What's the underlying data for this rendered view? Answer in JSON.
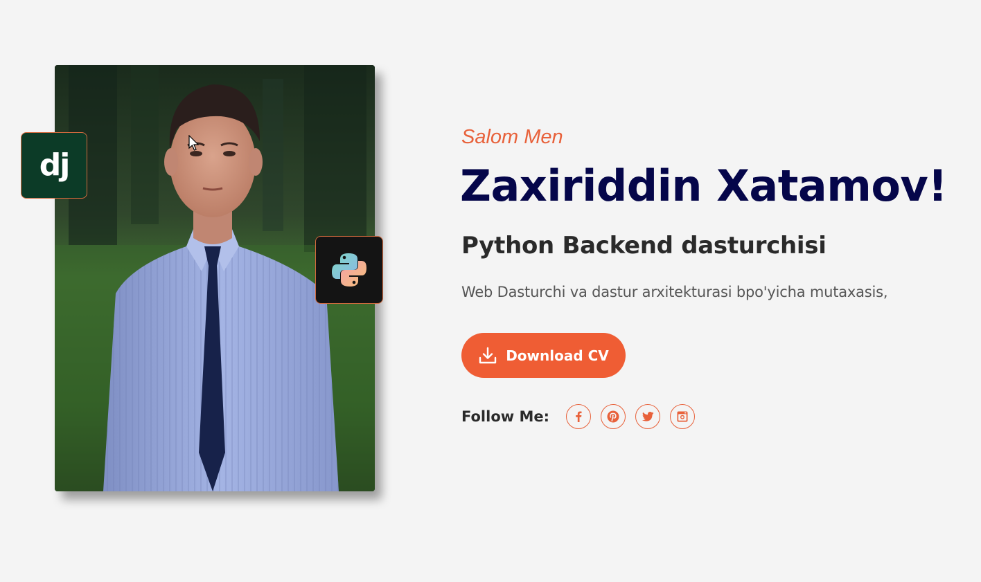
{
  "hero": {
    "greeting": "Salom Men",
    "name": "Zaxiriddin Xatamov!",
    "role": "Python Backend dasturchisi",
    "description": "Web Dasturchi va dastur arxitekturasi bpo'yicha mutaxasis,",
    "download_button": {
      "label": "Download CV",
      "icon": "download-icon"
    },
    "follow": {
      "label": "Follow Me:",
      "links": [
        {
          "name": "facebook",
          "icon": "facebook-icon"
        },
        {
          "name": "pinterest",
          "icon": "pinterest-icon"
        },
        {
          "name": "twitter",
          "icon": "twitter-icon"
        },
        {
          "name": "instagram",
          "icon": "instagram-icon"
        }
      ]
    },
    "badges": [
      {
        "name": "django",
        "logo_text": "dj",
        "icon": "django-logo-icon"
      },
      {
        "name": "python",
        "icon": "python-logo-icon"
      }
    ]
  },
  "colors": {
    "accent": "#ef5d34",
    "name_color": "#05064a",
    "background": "#f4f4f4",
    "django_bg": "#0c3b27",
    "python_bg": "#141414"
  }
}
